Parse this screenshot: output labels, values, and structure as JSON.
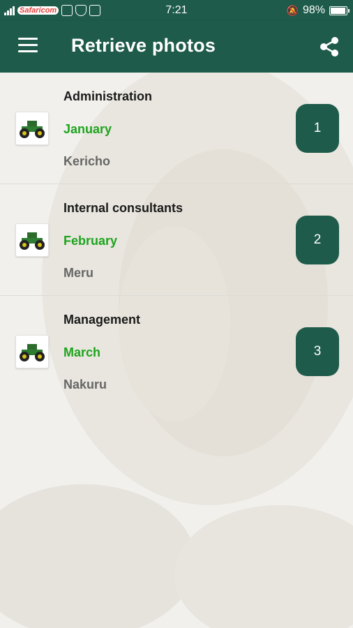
{
  "status_bar": {
    "carrier": "Safaricom",
    "time": "7:21",
    "battery": "98%"
  },
  "app_bar": {
    "title": "Retrieve photos",
    "menu_icon": "hamburger-menu-icon",
    "share_icon": "share-icon"
  },
  "colors": {
    "primary": "#1e5b4a",
    "month_green": "#1ea41e",
    "place_grey": "#666666"
  },
  "items": [
    {
      "title": "Administration",
      "month": "January",
      "place": "Kericho",
      "number": "1",
      "thumbnail": "tractor-icon"
    },
    {
      "title": "Internal consultants",
      "month": "February",
      "place": "Meru",
      "number": "2",
      "thumbnail": "tractor-icon"
    },
    {
      "title": "Management",
      "month": "March",
      "place": "Nakuru",
      "number": "3",
      "thumbnail": "tractor-icon"
    }
  ]
}
